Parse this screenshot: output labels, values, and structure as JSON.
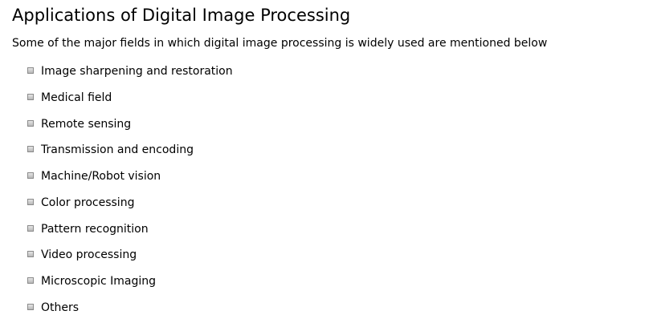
{
  "heading": "Applications of Digital Image Processing",
  "intro": "Some of the major fields in which digital image processing is widely used are mentioned below",
  "items": [
    "Image sharpening and restoration",
    "Medical field",
    "Remote sensing",
    "Transmission and encoding",
    "Machine/Robot vision",
    "Color processing",
    "Pattern recognition",
    "Video processing",
    "Microscopic Imaging",
    "Others"
  ],
  "bullet_icon": "square-bullet-icon"
}
